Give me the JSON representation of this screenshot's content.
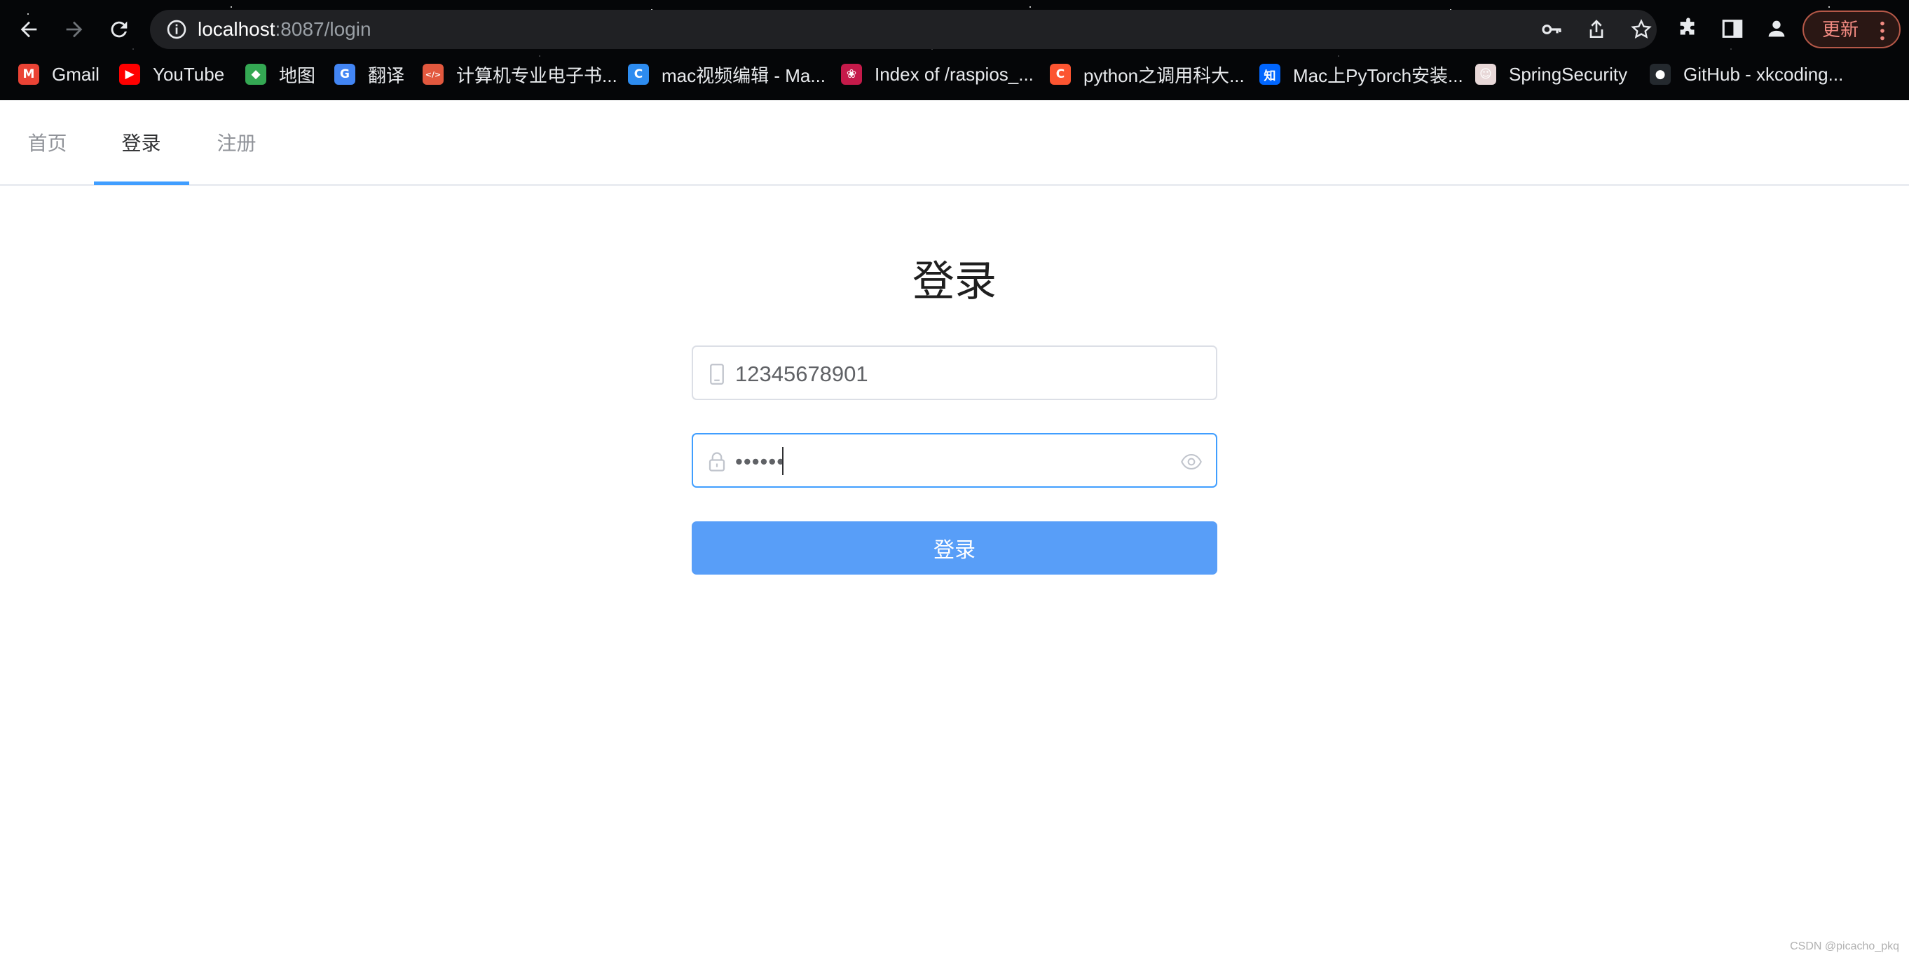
{
  "browser": {
    "url_host": "localhost",
    "url_path": ":8087/login",
    "update_label": "更新",
    "bookmarks": [
      {
        "label": "Gmail",
        "icon": "gmail-icon",
        "glyph": "M",
        "color": "#ea4335"
      },
      {
        "label": "YouTube",
        "icon": "youtube-icon",
        "glyph": "▶",
        "color": "#ff0000"
      },
      {
        "label": "地图",
        "icon": "maps-icon",
        "glyph": "◆",
        "color": "#34a853"
      },
      {
        "label": "翻译",
        "icon": "translate-icon",
        "glyph": "G",
        "color": "#4285f4"
      },
      {
        "label": "计算机专业电子书...",
        "icon": "code-icon",
        "glyph": "</>",
        "color": "#e2583e"
      },
      {
        "label": "mac视频编辑 - Ma...",
        "icon": "c-circle-icon",
        "glyph": "C",
        "color": "#2d8cf0"
      },
      {
        "label": "Index of /raspios_...",
        "icon": "raspberry-icon",
        "glyph": "❀",
        "color": "#c51a4a"
      },
      {
        "label": "python之调用科大...",
        "icon": "csdn-icon",
        "glyph": "C",
        "color": "#fc5531"
      },
      {
        "label": "Mac上PyTorch安装...",
        "icon": "zhihu-icon",
        "glyph": "知",
        "color": "#0066ff"
      },
      {
        "label": "SpringSecurity",
        "icon": "avatar-bookmark-icon",
        "glyph": "☺",
        "color": "#e8d8d8"
      },
      {
        "label": "GitHub - xkcoding...",
        "icon": "github-icon",
        "glyph": "●",
        "color": "#24292e"
      }
    ]
  },
  "nav": {
    "tabs": [
      {
        "label": "首页",
        "active": false
      },
      {
        "label": "登录",
        "active": true
      },
      {
        "label": "注册",
        "active": false
      }
    ]
  },
  "login": {
    "title": "登录",
    "phone_value": "12345678901",
    "password_masked": "••••••",
    "submit_label": "登录"
  },
  "watermark": "CSDN @picacho_pkq",
  "colors": {
    "accent": "#409eff",
    "button": "#589ef8",
    "update_border": "#b55848"
  }
}
